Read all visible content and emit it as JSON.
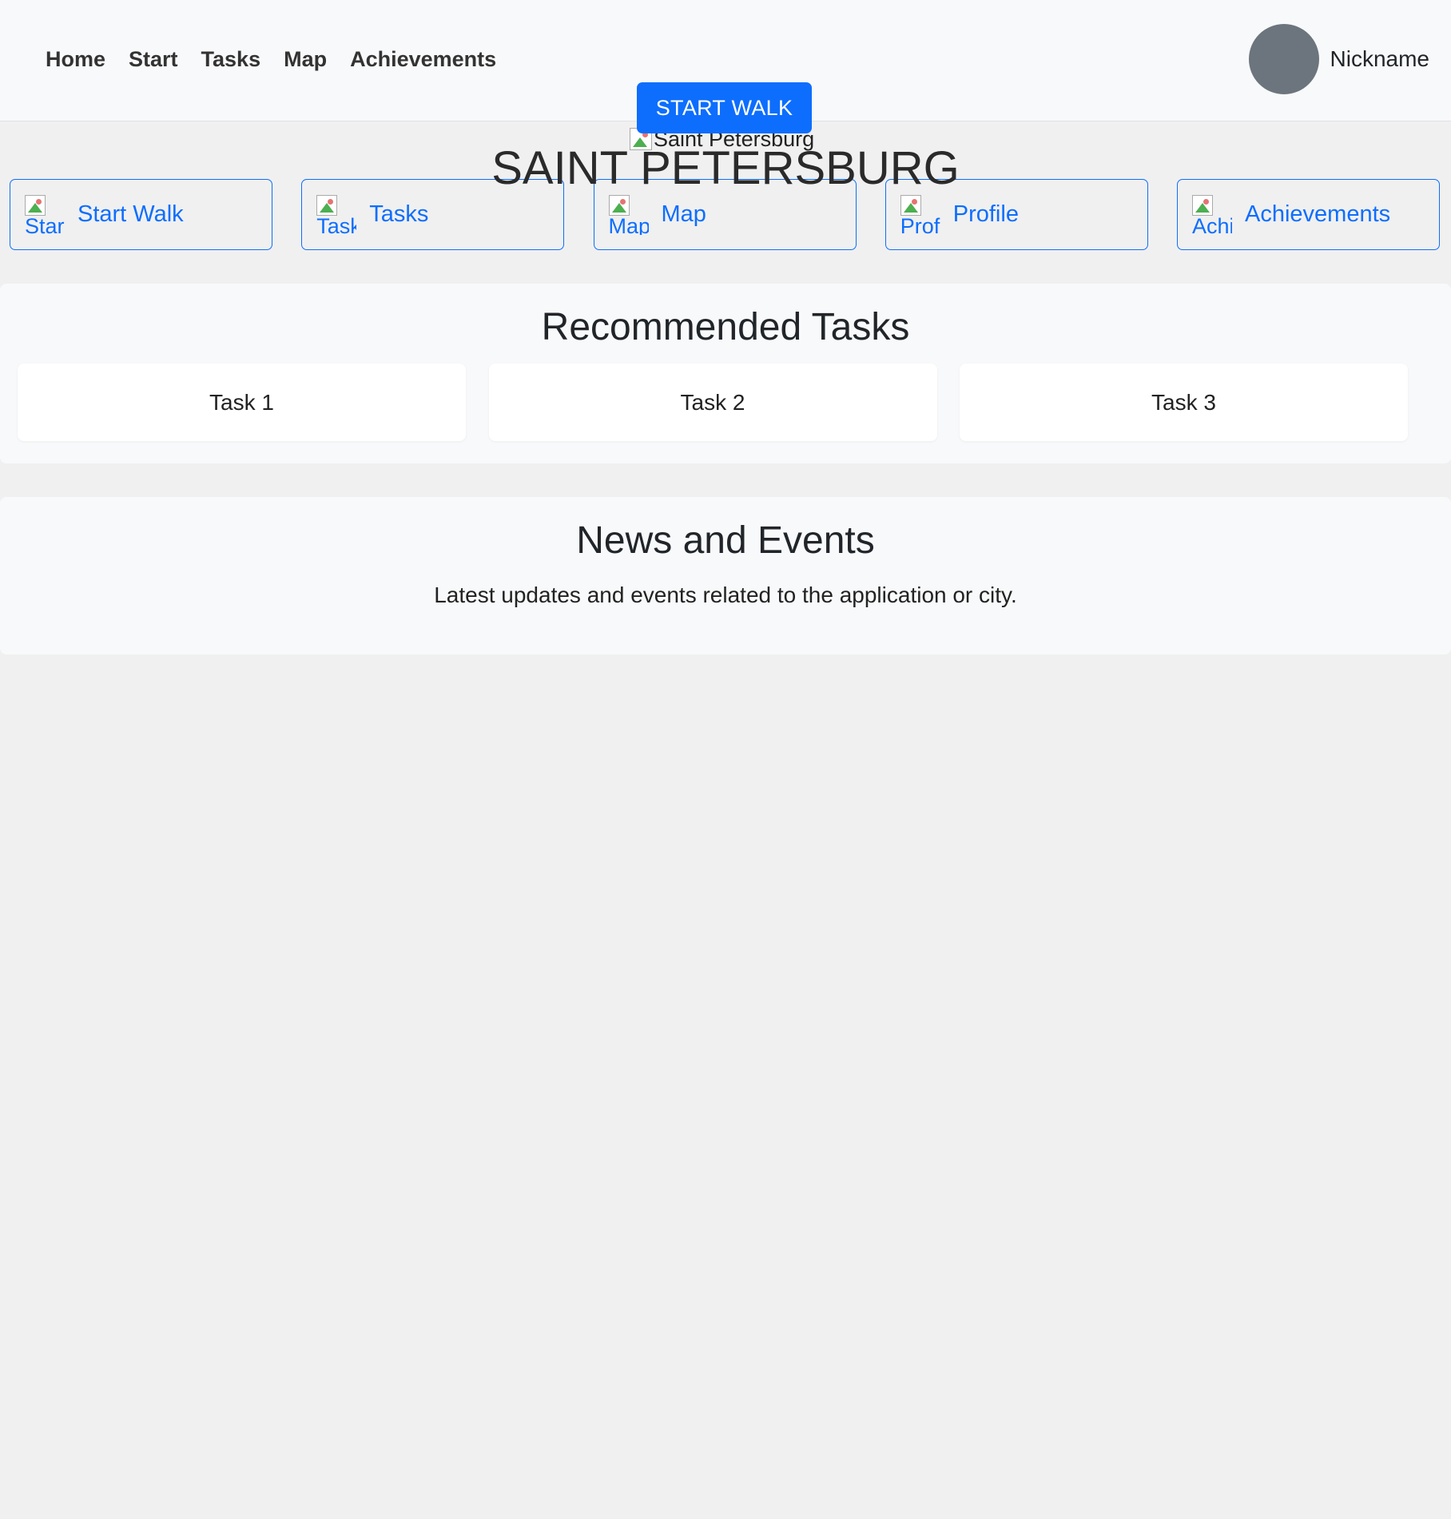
{
  "nav": {
    "items": [
      {
        "label": "Home"
      },
      {
        "label": "Start"
      },
      {
        "label": "Tasks"
      },
      {
        "label": "Map"
      },
      {
        "label": "Achievements"
      }
    ]
  },
  "header": {
    "start_walk_label": "START WALK",
    "nickname": "Nickname"
  },
  "hero": {
    "image_alt": "Saint Petersburg",
    "title": "SAINT PETERSBURG"
  },
  "quick_links": [
    {
      "label": "Start Walk",
      "icon_alt": "Star"
    },
    {
      "label": "Tasks",
      "icon_alt": "Task"
    },
    {
      "label": "Map",
      "icon_alt": "Map"
    },
    {
      "label": "Profile",
      "icon_alt": "Prof"
    },
    {
      "label": "Achievements",
      "icon_alt": "Achi"
    }
  ],
  "recommended": {
    "title": "Recommended Tasks",
    "tasks": [
      "Task 1",
      "Task 2",
      "Task 3"
    ]
  },
  "news": {
    "title": "News and Events",
    "text": "Latest updates and events related to the application or city."
  },
  "colors": {
    "primary": "#0d6efd",
    "avatar": "#6c757d",
    "page_bg": "#f0f0f0",
    "section_bg": "#f8f9fa"
  }
}
